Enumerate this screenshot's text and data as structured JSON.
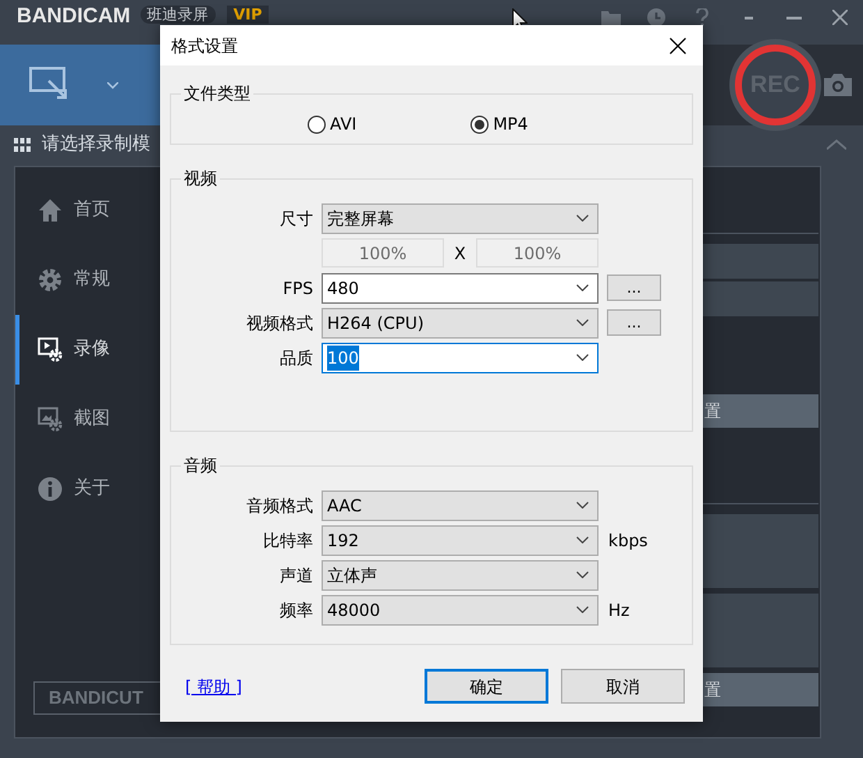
{
  "app": {
    "logo": "BANDICAM",
    "edition": "班迪录屏",
    "badge": "VIP",
    "mode_prompt": "请选择录制模",
    "record_label": "REC",
    "sidebar": [
      {
        "label": "首页",
        "selected": false
      },
      {
        "label": "常规",
        "selected": false
      },
      {
        "label": "录像",
        "selected": true
      },
      {
        "label": "截图",
        "selected": false
      },
      {
        "label": "关于",
        "selected": false
      }
    ],
    "bandicut_logo": "BANDICUT",
    "setting_buttons": [
      "置",
      "置"
    ]
  },
  "dialog": {
    "title": "格式设置",
    "file_type": {
      "legend": "文件类型",
      "options": [
        {
          "label": "AVI",
          "selected": false
        },
        {
          "label": "MP4",
          "selected": true
        }
      ]
    },
    "video": {
      "legend": "视频",
      "rows": [
        {
          "kind": "select",
          "label": "尺寸",
          "value": "完整屏幕"
        },
        {
          "kind": "scale",
          "values": [
            "100%",
            "100%"
          ],
          "separator": "X"
        },
        {
          "kind": "combo",
          "label": "FPS",
          "value": "480",
          "more": "..."
        },
        {
          "kind": "select",
          "label": "视频格式",
          "value": "H264 (CPU)",
          "more": "..."
        },
        {
          "kind": "combo",
          "label": "品质",
          "value": "100",
          "focused": true
        }
      ]
    },
    "audio": {
      "legend": "音频",
      "rows": [
        {
          "label": "音频格式",
          "value": "AAC"
        },
        {
          "label": "比特率",
          "value": "192",
          "unit": "kbps"
        },
        {
          "label": "声道",
          "value": "立体声"
        },
        {
          "label": "频率",
          "value": "48000",
          "unit": "Hz"
        }
      ]
    },
    "help_link": "[ 帮助 ]",
    "buttons": [
      {
        "label": "确定",
        "default": true
      },
      {
        "label": "取消",
        "default": false
      }
    ]
  }
}
